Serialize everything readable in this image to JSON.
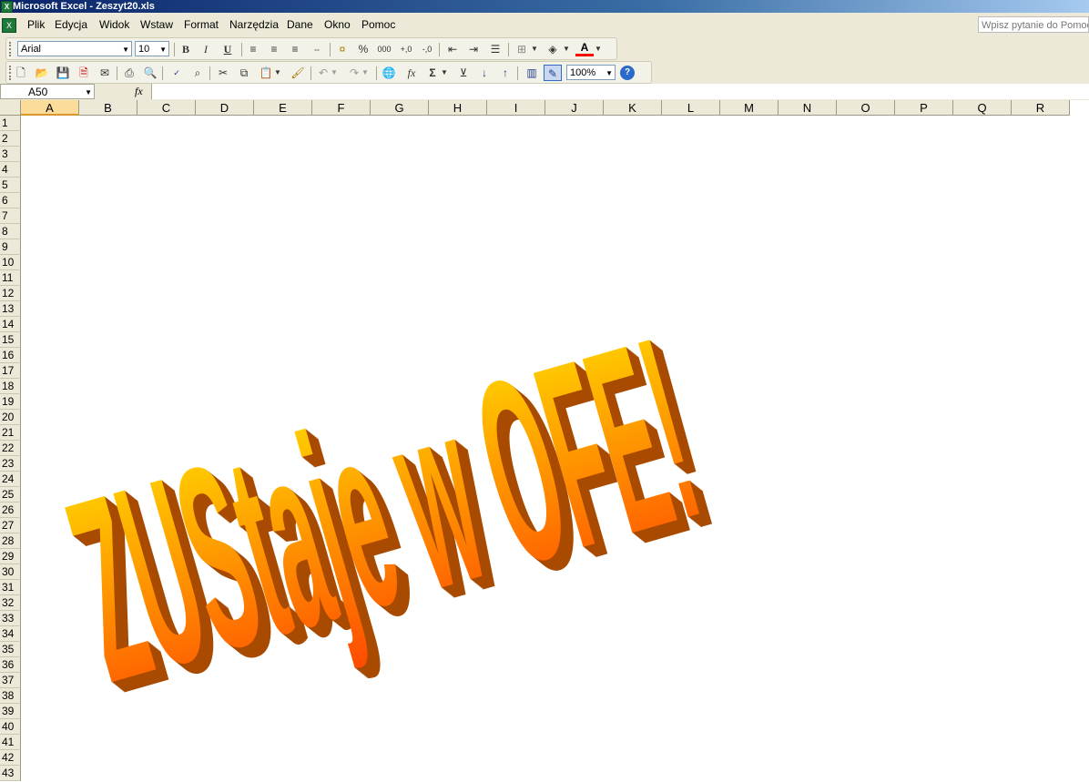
{
  "window": {
    "title": "Microsoft Excel - Zeszyt20.xls",
    "app_icon": "excel-icon"
  },
  "menu": {
    "items": [
      "Plik",
      "Edycja",
      "Widok",
      "Wstaw",
      "Format",
      "Narzędzia",
      "Dane",
      "Okno",
      "Pomoc"
    ],
    "help_placeholder": "Wpisz pytanie do Pomocy"
  },
  "format_toolbar": {
    "font": "Arial",
    "size": "10",
    "bold": "B",
    "italic": "I",
    "underline": "U",
    "percent": "%",
    "thousands": "000",
    "font_color_letter": "A",
    "accent_red": "#ff0000"
  },
  "standard_toolbar": {
    "zoom": "100%",
    "sum": "Σ",
    "fx": "fx",
    "help_glyph": "?"
  },
  "formula_bar": {
    "name_box": "A50",
    "fx_label": "fx",
    "content": ""
  },
  "sheet": {
    "columns": [
      "A",
      "B",
      "C",
      "D",
      "E",
      "F",
      "G",
      "H",
      "I",
      "J",
      "K",
      "L",
      "M",
      "N",
      "O",
      "P",
      "Q",
      "R"
    ],
    "active_column": "A",
    "rows": [
      "1",
      "2",
      "3",
      "4",
      "5",
      "6",
      "7",
      "8",
      "9",
      "10",
      "11",
      "12",
      "13",
      "14",
      "15",
      "16",
      "17",
      "18",
      "19",
      "20",
      "21",
      "22",
      "23",
      "24",
      "25",
      "26",
      "27",
      "28",
      "29",
      "30",
      "31",
      "32",
      "33",
      "34",
      "35",
      "36",
      "37",
      "38",
      "39",
      "40",
      "41",
      "42",
      "43"
    ]
  },
  "wordart": {
    "text": "ZUStaje w OFE!",
    "colors": {
      "top": "#ffe400",
      "bottom": "#ff4a00",
      "side": "#a84a00"
    }
  }
}
